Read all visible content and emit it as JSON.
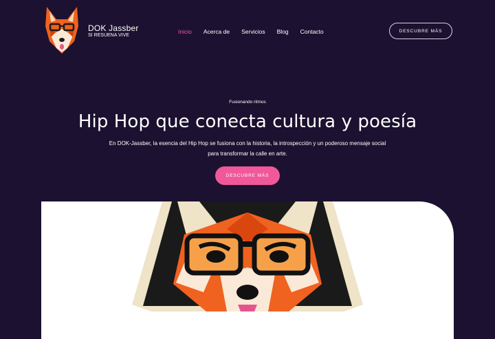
{
  "brand": {
    "name": "DOK Jassber",
    "tagline": "SI RESUENA VIVE"
  },
  "nav": {
    "items": [
      {
        "label": "Inicio",
        "active": true
      },
      {
        "label": "Acerca de"
      },
      {
        "label": "Servicios"
      },
      {
        "label": "Blog"
      },
      {
        "label": "Contacto"
      }
    ]
  },
  "header_button": {
    "label": "DESCUBRE MÁS"
  },
  "hero": {
    "eyebrow": "Fusionando ritmos",
    "title": "Hip Hop que conecta cultura y poesía",
    "text_line1": "En DOK-Jassber, la esencia del Hip Hop se fusiona con la historia, la introspección y un poderoso mensaje social",
    "text_line2": "para transformar la calle en arte.",
    "cta_label": "DESCUBRE MÁS"
  },
  "colors": {
    "background": "#1c1130",
    "accent": "#f0589a",
    "fox_orange": "#f0621f",
    "panel": "#ffffff"
  },
  "icons": {
    "logo": "fox-with-glasses-logo",
    "hero_image": "fox-with-glasses-illustration"
  }
}
